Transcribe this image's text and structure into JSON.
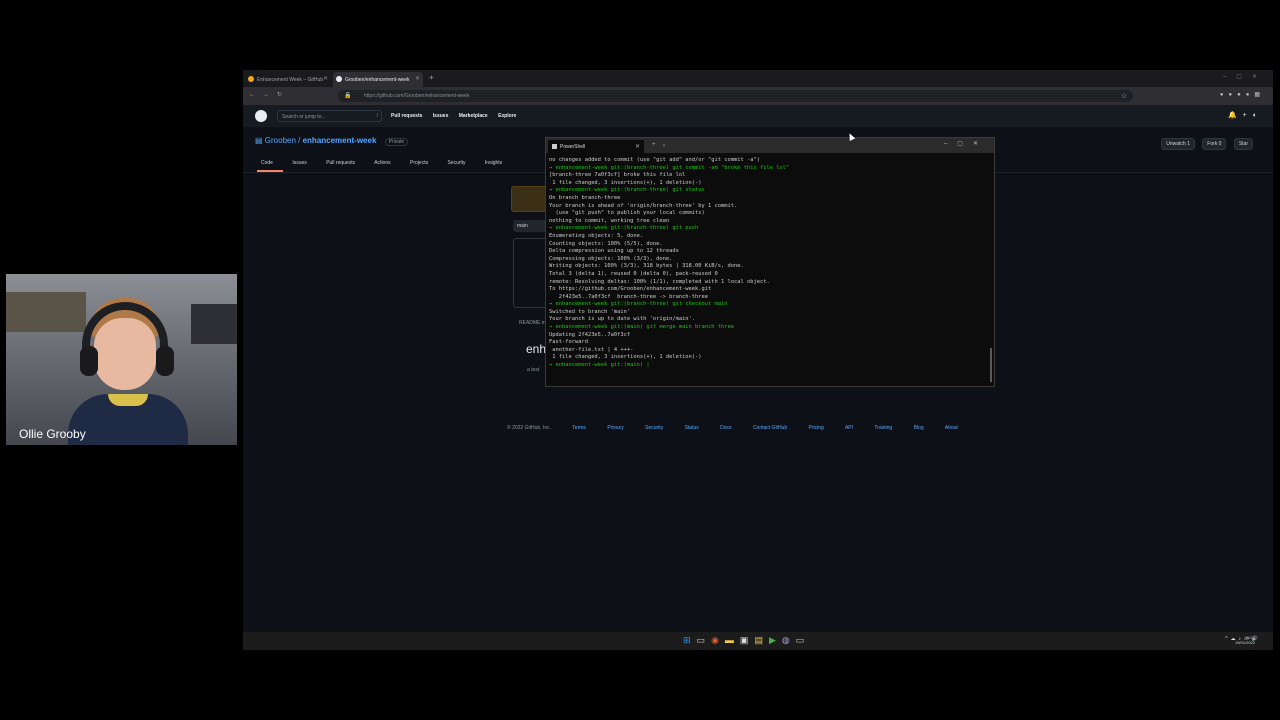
{
  "browser": {
    "tabs": [
      {
        "title": "Enhancement Week – GitHub"
      },
      {
        "title": "Grooben/enhancement-week"
      }
    ],
    "new_tab": "+",
    "url": "https://github.com/Grooben/enhancement-week"
  },
  "github": {
    "search_placeholder": "Search or jump to...",
    "search_shortcut": "/",
    "nav": [
      "Pull requests",
      "Issues",
      "Marketplace",
      "Explore"
    ],
    "repo_owner": "Grooben",
    "repo_sep": " / ",
    "repo_name": "enhancement-week",
    "visibility": "Private",
    "repo_tabs": [
      "Code",
      "Issues",
      "Pull requests",
      "Actions",
      "Projects",
      "Security",
      "Insights"
    ],
    "actions": [
      "Unwatch 1",
      "Fork 0",
      "Star"
    ],
    "branch": "main",
    "readme_label": "README.md",
    "readme_title": "enh",
    "readme_text": "a test",
    "footer_copyright": "© 2022 GitHub, Inc.",
    "footer_links": [
      "Terms",
      "Privacy",
      "Security",
      "Status",
      "Docs",
      "Contact GitHub",
      "Pricing",
      "API",
      "Training",
      "Blog",
      "About"
    ]
  },
  "terminal": {
    "tab_title": "PowerShell",
    "lines": [
      {
        "cls": "",
        "text": "no changes added to commit (use \"git add\" and/or \"git commit -a\")"
      },
      {
        "cls": "g",
        "text": "→ enhancement-week git:(branch-three) git commit -am \"broke this file lol\""
      },
      {
        "cls": "",
        "text": "[branch-three 7a0f3cf] broke this file lol"
      },
      {
        "cls": "",
        "text": " 1 file changed, 3 insertions(+), 1 deletion(-)"
      },
      {
        "cls": "g",
        "text": "→ enhancement-week git:(branch-three) git status"
      },
      {
        "cls": "",
        "text": "On branch branch-three"
      },
      {
        "cls": "",
        "text": "Your branch is ahead of 'origin/branch-three' by 1 commit."
      },
      {
        "cls": "",
        "text": "  (use \"git push\" to publish your local commits)"
      },
      {
        "cls": "",
        "text": ""
      },
      {
        "cls": "",
        "text": "nothing to commit, working tree clean"
      },
      {
        "cls": "g",
        "text": "→ enhancement-week git:(branch-three) git push"
      },
      {
        "cls": "",
        "text": "Enumerating objects: 5, done."
      },
      {
        "cls": "",
        "text": "Counting objects: 100% (5/5), done."
      },
      {
        "cls": "",
        "text": "Delta compression using up to 12 threads"
      },
      {
        "cls": "",
        "text": "Compressing objects: 100% (3/3), done."
      },
      {
        "cls": "",
        "text": "Writing objects: 100% (3/3), 318 bytes | 318.00 KiB/s, done."
      },
      {
        "cls": "",
        "text": "Total 3 (delta 1), reused 0 (delta 0), pack-reused 0"
      },
      {
        "cls": "",
        "text": "remote: Resolving deltas: 100% (1/1), completed with 1 local object."
      },
      {
        "cls": "",
        "text": "To https://github.com/Grooben/enhancement-week.git"
      },
      {
        "cls": "",
        "text": "   2f423e5..7a0f3cf  branch-three -> branch-three"
      },
      {
        "cls": "g",
        "text": "→ enhancement-week git:(branch-three) git checkout main"
      },
      {
        "cls": "",
        "text": "Switched to branch 'main'"
      },
      {
        "cls": "",
        "text": "Your branch is up to date with 'origin/main'."
      },
      {
        "cls": "g",
        "text": "→ enhancement-week git:(main) git merge main branch three"
      },
      {
        "cls": "",
        "text": "Updating 2f423e5..7a0f3cf"
      },
      {
        "cls": "",
        "text": "Fast-forward"
      },
      {
        "cls": "",
        "text": " another-file.txt | 4 +++-"
      },
      {
        "cls": "",
        "text": " 1 file changed, 3 insertions(+), 1 deletion(-)"
      },
      {
        "cls": "g",
        "text": "→ enhancement-week git:(main) |"
      }
    ]
  },
  "taskbar": {
    "time": "10:22",
    "date": "19/01/2022"
  },
  "webcam": {
    "name": "Ollie Grooby"
  },
  "colors": {
    "accent_link": "#58a6ff",
    "prompt_green": "#16c60c",
    "tab_underline": "#f78166"
  }
}
